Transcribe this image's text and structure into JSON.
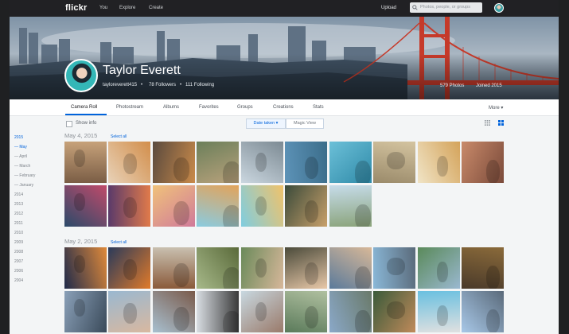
{
  "topnav": {
    "logo": "flickr",
    "links": [
      "You",
      "Explore",
      "Create"
    ],
    "upload": "Upload",
    "search_placeholder": "Photos, people, or groups"
  },
  "profile": {
    "name": "Taylor Everett",
    "username": "tayloreverett415",
    "followers": "78 Followers",
    "following": "111 Following",
    "photos": "579 Photos",
    "joined": "Joined 2015"
  },
  "tabs": [
    "Camera Roll",
    "Photostream",
    "Albums",
    "Favorites",
    "Groups",
    "Creations",
    "Stats"
  ],
  "more": "More ▾",
  "toolbar": {
    "show_info": "Show info",
    "date_taken": "Date taken ▾",
    "magic_view": "Magic View"
  },
  "sidebar": {
    "year_active": "2015",
    "months": [
      "— May",
      "— April",
      "— March",
      "— February",
      "— January"
    ],
    "years": [
      "2014",
      "2013",
      "2012",
      "2011",
      "2010",
      "2009",
      "2008",
      "2007",
      "2006",
      "2004"
    ]
  },
  "sections": [
    {
      "date": "May 4, 2015",
      "select_all": "Select all"
    },
    {
      "date": "May 2, 2015",
      "select_all": "Select all"
    }
  ],
  "colors": {
    "accent": "#0063dc",
    "nav_bg": "#212124",
    "page_bg": "#f3f5f6"
  }
}
